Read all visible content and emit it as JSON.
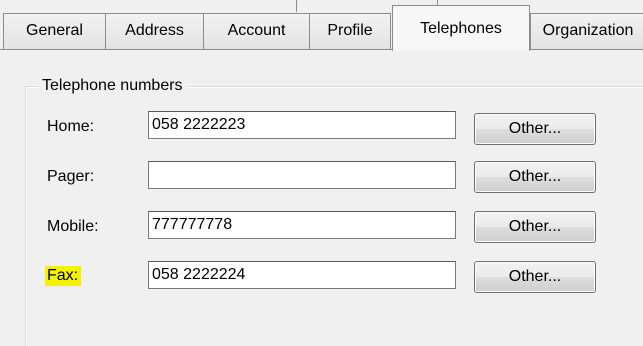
{
  "tabs": [
    {
      "label": "General",
      "active": false
    },
    {
      "label": "Address",
      "active": false
    },
    {
      "label": "Account",
      "active": false
    },
    {
      "label": "Profile",
      "active": false
    },
    {
      "label": "Telephones",
      "active": true
    },
    {
      "label": "Organization",
      "active": false
    }
  ],
  "telephone_group": {
    "title": "Telephone numbers",
    "rows": [
      {
        "label": "Home:",
        "value": "058 2222223",
        "button": "Other..."
      },
      {
        "label": "Pager:",
        "value": "",
        "button": "Other..."
      },
      {
        "label": "Mobile:",
        "value": "777777778",
        "button": "Other..."
      },
      {
        "label": "Fax:",
        "value": "058 2222224",
        "button": "Other...",
        "highlighted": true
      }
    ]
  },
  "colors": {
    "highlight": "#f5f200",
    "background": "#f0f0f0",
    "border": "#898c95"
  }
}
